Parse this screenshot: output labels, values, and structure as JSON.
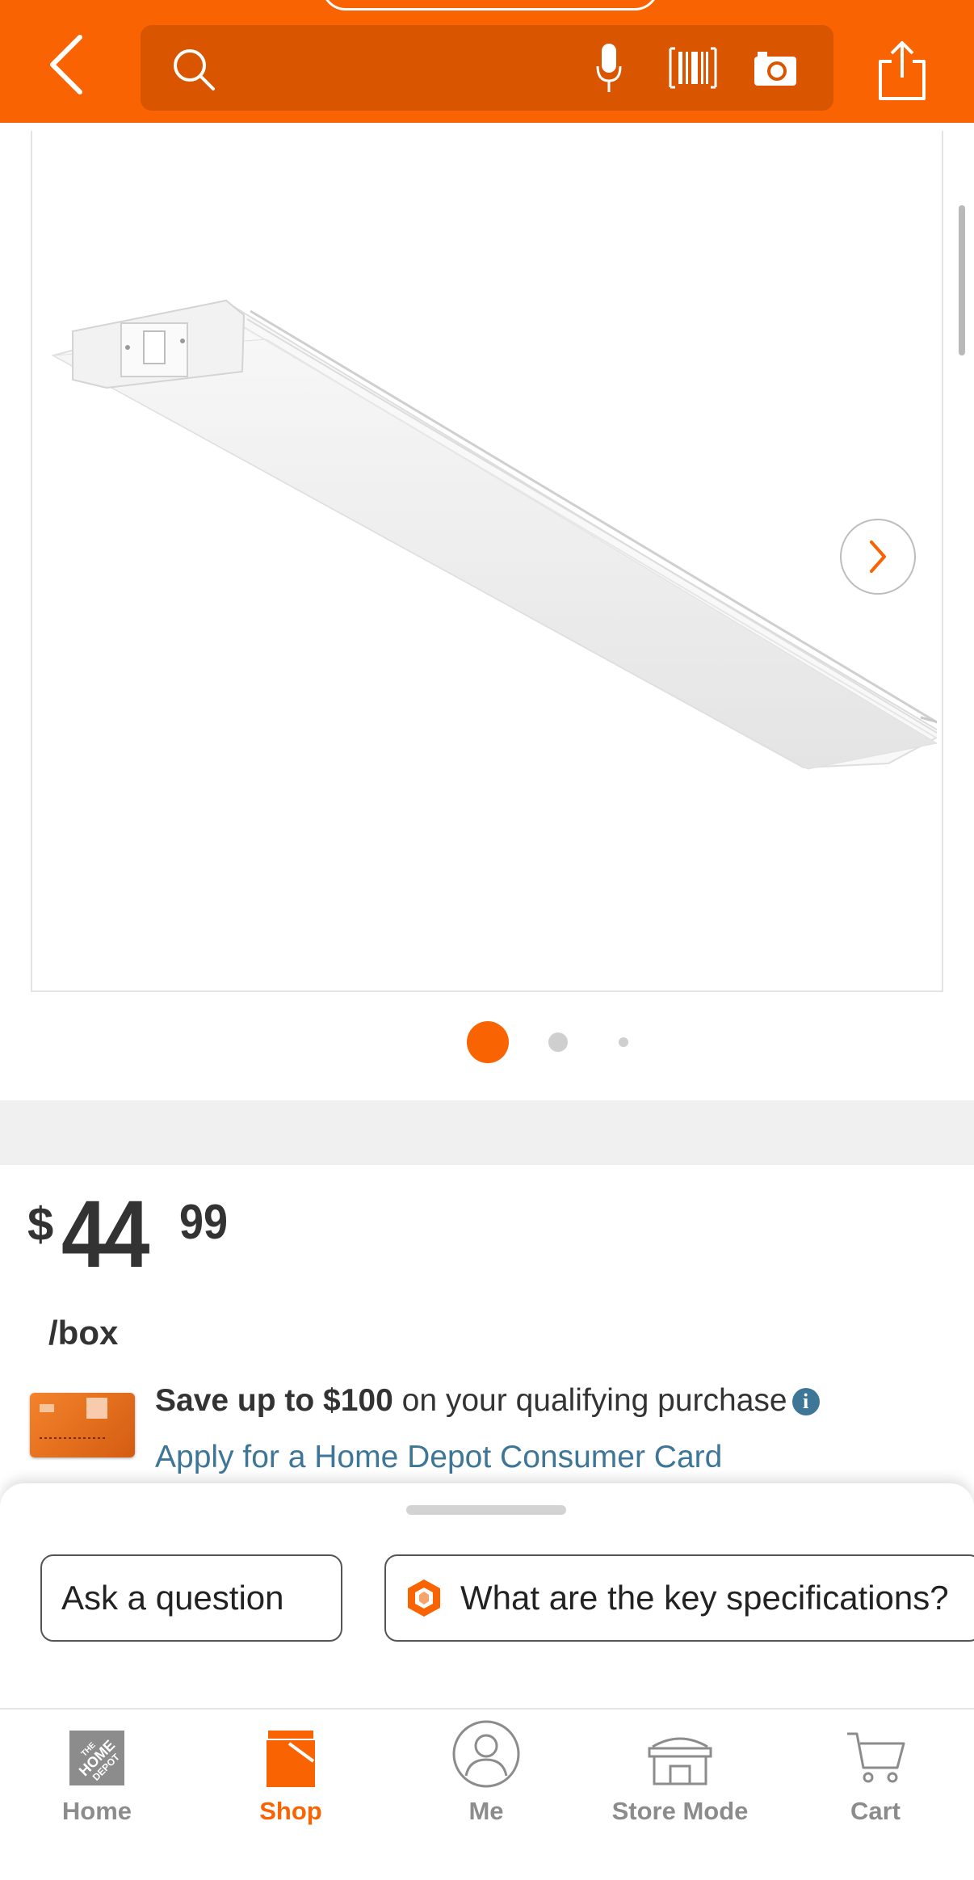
{
  "colors": {
    "brand": "#f96302",
    "search_bg": "#d95500",
    "link": "#3e7697",
    "inactive": "#8c8c8c"
  },
  "header": {
    "icons": [
      "back-icon",
      "search-icon",
      "microphone-icon",
      "barcode-icon",
      "camera-icon",
      "share-icon"
    ]
  },
  "gallery": {
    "image_count": 3,
    "active_index": 1
  },
  "price": {
    "symbol": "$",
    "dollars": "44",
    "cents": "99",
    "unit": "/box"
  },
  "promo": {
    "bold_text": "Save up to $100",
    "text": " on your qualifying purchase",
    "link_text": "Apply for a Home Depot Consumer Card"
  },
  "chips": [
    {
      "label": "Ask a question"
    },
    {
      "label": "What are the key specifications?"
    }
  ],
  "nav": {
    "items": [
      {
        "label": "Home",
        "icon": "home-depot-logo-icon",
        "active": false
      },
      {
        "label": "Shop",
        "icon": "shop-icon",
        "active": true
      },
      {
        "label": "Me",
        "icon": "user-icon",
        "active": false
      },
      {
        "label": "Store Mode",
        "icon": "store-icon",
        "active": false
      },
      {
        "label": "Cart",
        "icon": "cart-icon",
        "active": false
      }
    ]
  }
}
